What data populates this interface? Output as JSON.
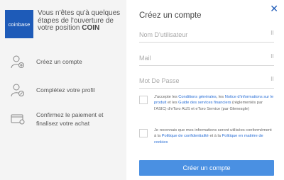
{
  "brand": {
    "logo_text": "coinbase",
    "intro_prefix": "Vous n'êtes qu'à quelques étapes de l'ouverture de votre position ",
    "intro_bold": "COIN"
  },
  "steps": [
    {
      "label": "Créez un compte",
      "icon": "add-user-icon"
    },
    {
      "label": "Complétez votre profil",
      "icon": "profile-edit-icon"
    },
    {
      "label": "Confirmez le paiement et finalisez votre achat",
      "icon": "payment-card-icon"
    }
  ],
  "form": {
    "title": "Créez un compte",
    "close_glyph": "✕",
    "fields": [
      {
        "placeholder": "Nom D'utilisateur",
        "value": ""
      },
      {
        "placeholder": "Mail",
        "value": ""
      },
      {
        "placeholder": "Mot De Passe",
        "value": ""
      }
    ],
    "field_icon_glyph": "⠿",
    "terms": {
      "t1": "J'accepte les ",
      "l1": "Conditions générales",
      "t2": ", les ",
      "l2": "Notice d'informations sur le produit",
      "t3": " et les ",
      "l3": "Guide des services financiers",
      "t4": " (réglementés par l'ASIC) d'eToro AUS et eToro Service (par Glenesgle)"
    },
    "privacy": {
      "t1": "Je reconnais que mes informations seront utilisées conformément à la ",
      "l1": "Politique de confidentialité",
      "t2": " et à la ",
      "l2": "Politique en matière de cookies"
    },
    "submit_label": "Créer un compte"
  },
  "colors": {
    "brand_blue": "#1e5bb8",
    "button_blue": "#4a90e2",
    "link_blue": "#2a6fd6"
  }
}
